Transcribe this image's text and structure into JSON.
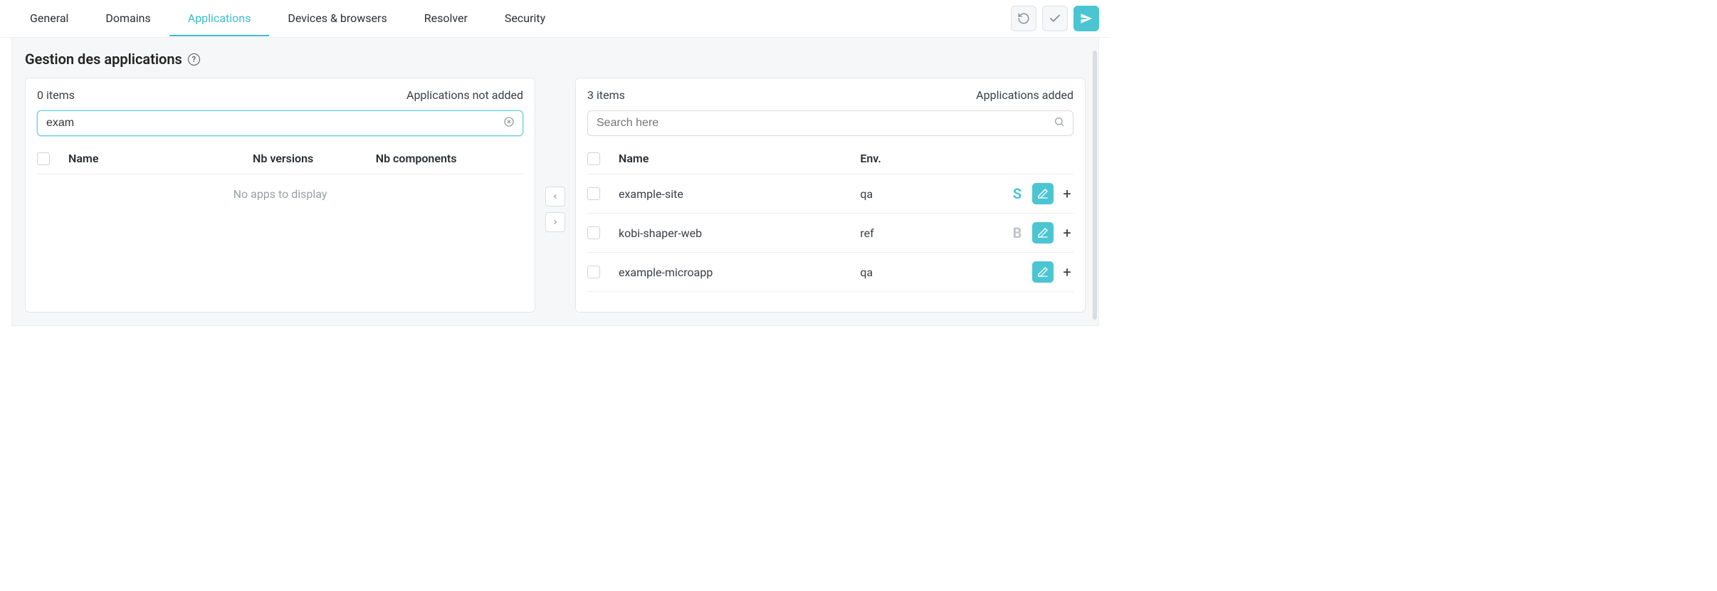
{
  "tabs": [
    {
      "label": "General"
    },
    {
      "label": "Domains"
    },
    {
      "label": "Applications"
    },
    {
      "label": "Devices & browsers"
    },
    {
      "label": "Resolver"
    },
    {
      "label": "Security"
    }
  ],
  "section": {
    "title": "Gestion des applications"
  },
  "left": {
    "count_label": "0 items",
    "title": "Applications not added",
    "search_value": "exam",
    "columns": {
      "name": "Name",
      "versions": "Nb versions",
      "components": "Nb components"
    },
    "empty_text": "No apps to display"
  },
  "right": {
    "count_label": "3 items",
    "title": "Applications added",
    "search_placeholder": "Search here",
    "columns": {
      "name": "Name",
      "env": "Env."
    },
    "rows": [
      {
        "name": "example-site",
        "env": "qa",
        "badge": "S",
        "badge_style": "s"
      },
      {
        "name": "kobi-shaper-web",
        "env": "ref",
        "badge": "B",
        "badge_style": ""
      },
      {
        "name": "example-microapp",
        "env": "qa",
        "badge": "",
        "badge_style": ""
      }
    ]
  }
}
